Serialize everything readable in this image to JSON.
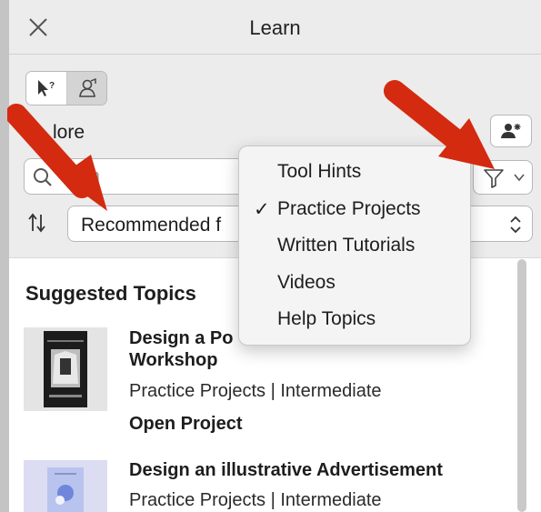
{
  "window": {
    "title": "Learn"
  },
  "toolbar": {
    "explore_label": "lore",
    "search_placeholder": "arch",
    "sort_value": "Recommended f"
  },
  "filter_menu": {
    "items": [
      {
        "label": "Tool Hints",
        "checked": ""
      },
      {
        "label": "Practice Projects",
        "checked": "✓"
      },
      {
        "label": "Written Tutorials",
        "checked": ""
      },
      {
        "label": "Videos",
        "checked": ""
      },
      {
        "label": "Help Topics",
        "checked": ""
      }
    ]
  },
  "content": {
    "section_title": "Suggested Topics",
    "items": [
      {
        "title_line1": "Design a Po",
        "title_line2": "Workshop",
        "meta": "Practice Projects | Intermediate",
        "action": "Open Project"
      },
      {
        "title_line1": "Design an illustrative Advertisement",
        "meta": "Practice Projects | Intermediate"
      }
    ]
  },
  "colors": {
    "annotation_arrow": "#d42a10",
    "menu_background": "#f4f4f4",
    "panel_background": "#ececec"
  },
  "icons": [
    "close-icon",
    "pointer-help-icon",
    "learn-person-icon",
    "add-person-icon",
    "search-icon",
    "filter-icon",
    "chevron-down-icon",
    "sort-icon",
    "stepper-icon",
    "checkmark-icon"
  ]
}
